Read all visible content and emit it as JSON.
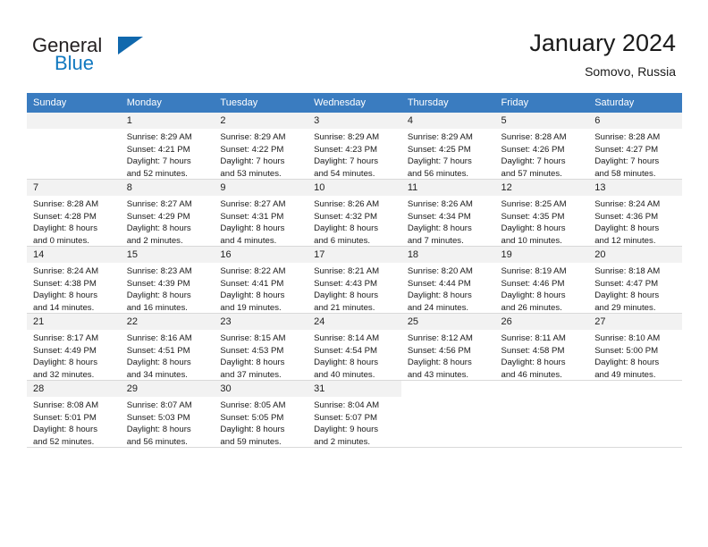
{
  "brand": {
    "name_part1": "General",
    "name_part2": "Blue",
    "accent_color": "#1279c0",
    "triangle_color": "#1068ad"
  },
  "header": {
    "title": "January 2024",
    "subtitle": "Somovo, Russia"
  },
  "calendar": {
    "header_bg": "#3a7cc0",
    "weekdays": [
      "Sunday",
      "Monday",
      "Tuesday",
      "Wednesday",
      "Thursday",
      "Friday",
      "Saturday"
    ],
    "weeks": [
      [
        {
          "day": "",
          "sunrise": "",
          "sunset": "",
          "daylight1": "",
          "daylight2": ""
        },
        {
          "day": "1",
          "sunrise": "Sunrise: 8:29 AM",
          "sunset": "Sunset: 4:21 PM",
          "daylight1": "Daylight: 7 hours",
          "daylight2": "and 52 minutes."
        },
        {
          "day": "2",
          "sunrise": "Sunrise: 8:29 AM",
          "sunset": "Sunset: 4:22 PM",
          "daylight1": "Daylight: 7 hours",
          "daylight2": "and 53 minutes."
        },
        {
          "day": "3",
          "sunrise": "Sunrise: 8:29 AM",
          "sunset": "Sunset: 4:23 PM",
          "daylight1": "Daylight: 7 hours",
          "daylight2": "and 54 minutes."
        },
        {
          "day": "4",
          "sunrise": "Sunrise: 8:29 AM",
          "sunset": "Sunset: 4:25 PM",
          "daylight1": "Daylight: 7 hours",
          "daylight2": "and 56 minutes."
        },
        {
          "day": "5",
          "sunrise": "Sunrise: 8:28 AM",
          "sunset": "Sunset: 4:26 PM",
          "daylight1": "Daylight: 7 hours",
          "daylight2": "and 57 minutes."
        },
        {
          "day": "6",
          "sunrise": "Sunrise: 8:28 AM",
          "sunset": "Sunset: 4:27 PM",
          "daylight1": "Daylight: 7 hours",
          "daylight2": "and 58 minutes."
        }
      ],
      [
        {
          "day": "7",
          "sunrise": "Sunrise: 8:28 AM",
          "sunset": "Sunset: 4:28 PM",
          "daylight1": "Daylight: 8 hours",
          "daylight2": "and 0 minutes."
        },
        {
          "day": "8",
          "sunrise": "Sunrise: 8:27 AM",
          "sunset": "Sunset: 4:29 PM",
          "daylight1": "Daylight: 8 hours",
          "daylight2": "and 2 minutes."
        },
        {
          "day": "9",
          "sunrise": "Sunrise: 8:27 AM",
          "sunset": "Sunset: 4:31 PM",
          "daylight1": "Daylight: 8 hours",
          "daylight2": "and 4 minutes."
        },
        {
          "day": "10",
          "sunrise": "Sunrise: 8:26 AM",
          "sunset": "Sunset: 4:32 PM",
          "daylight1": "Daylight: 8 hours",
          "daylight2": "and 6 minutes."
        },
        {
          "day": "11",
          "sunrise": "Sunrise: 8:26 AM",
          "sunset": "Sunset: 4:34 PM",
          "daylight1": "Daylight: 8 hours",
          "daylight2": "and 7 minutes."
        },
        {
          "day": "12",
          "sunrise": "Sunrise: 8:25 AM",
          "sunset": "Sunset: 4:35 PM",
          "daylight1": "Daylight: 8 hours",
          "daylight2": "and 10 minutes."
        },
        {
          "day": "13",
          "sunrise": "Sunrise: 8:24 AM",
          "sunset": "Sunset: 4:36 PM",
          "daylight1": "Daylight: 8 hours",
          "daylight2": "and 12 minutes."
        }
      ],
      [
        {
          "day": "14",
          "sunrise": "Sunrise: 8:24 AM",
          "sunset": "Sunset: 4:38 PM",
          "daylight1": "Daylight: 8 hours",
          "daylight2": "and 14 minutes."
        },
        {
          "day": "15",
          "sunrise": "Sunrise: 8:23 AM",
          "sunset": "Sunset: 4:39 PM",
          "daylight1": "Daylight: 8 hours",
          "daylight2": "and 16 minutes."
        },
        {
          "day": "16",
          "sunrise": "Sunrise: 8:22 AM",
          "sunset": "Sunset: 4:41 PM",
          "daylight1": "Daylight: 8 hours",
          "daylight2": "and 19 minutes."
        },
        {
          "day": "17",
          "sunrise": "Sunrise: 8:21 AM",
          "sunset": "Sunset: 4:43 PM",
          "daylight1": "Daylight: 8 hours",
          "daylight2": "and 21 minutes."
        },
        {
          "day": "18",
          "sunrise": "Sunrise: 8:20 AM",
          "sunset": "Sunset: 4:44 PM",
          "daylight1": "Daylight: 8 hours",
          "daylight2": "and 24 minutes."
        },
        {
          "day": "19",
          "sunrise": "Sunrise: 8:19 AM",
          "sunset": "Sunset: 4:46 PM",
          "daylight1": "Daylight: 8 hours",
          "daylight2": "and 26 minutes."
        },
        {
          "day": "20",
          "sunrise": "Sunrise: 8:18 AM",
          "sunset": "Sunset: 4:47 PM",
          "daylight1": "Daylight: 8 hours",
          "daylight2": "and 29 minutes."
        }
      ],
      [
        {
          "day": "21",
          "sunrise": "Sunrise: 8:17 AM",
          "sunset": "Sunset: 4:49 PM",
          "daylight1": "Daylight: 8 hours",
          "daylight2": "and 32 minutes."
        },
        {
          "day": "22",
          "sunrise": "Sunrise: 8:16 AM",
          "sunset": "Sunset: 4:51 PM",
          "daylight1": "Daylight: 8 hours",
          "daylight2": "and 34 minutes."
        },
        {
          "day": "23",
          "sunrise": "Sunrise: 8:15 AM",
          "sunset": "Sunset: 4:53 PM",
          "daylight1": "Daylight: 8 hours",
          "daylight2": "and 37 minutes."
        },
        {
          "day": "24",
          "sunrise": "Sunrise: 8:14 AM",
          "sunset": "Sunset: 4:54 PM",
          "daylight1": "Daylight: 8 hours",
          "daylight2": "and 40 minutes."
        },
        {
          "day": "25",
          "sunrise": "Sunrise: 8:12 AM",
          "sunset": "Sunset: 4:56 PM",
          "daylight1": "Daylight: 8 hours",
          "daylight2": "and 43 minutes."
        },
        {
          "day": "26",
          "sunrise": "Sunrise: 8:11 AM",
          "sunset": "Sunset: 4:58 PM",
          "daylight1": "Daylight: 8 hours",
          "daylight2": "and 46 minutes."
        },
        {
          "day": "27",
          "sunrise": "Sunrise: 8:10 AM",
          "sunset": "Sunset: 5:00 PM",
          "daylight1": "Daylight: 8 hours",
          "daylight2": "and 49 minutes."
        }
      ],
      [
        {
          "day": "28",
          "sunrise": "Sunrise: 8:08 AM",
          "sunset": "Sunset: 5:01 PM",
          "daylight1": "Daylight: 8 hours",
          "daylight2": "and 52 minutes."
        },
        {
          "day": "29",
          "sunrise": "Sunrise: 8:07 AM",
          "sunset": "Sunset: 5:03 PM",
          "daylight1": "Daylight: 8 hours",
          "daylight2": "and 56 minutes."
        },
        {
          "day": "30",
          "sunrise": "Sunrise: 8:05 AM",
          "sunset": "Sunset: 5:05 PM",
          "daylight1": "Daylight: 8 hours",
          "daylight2": "and 59 minutes."
        },
        {
          "day": "31",
          "sunrise": "Sunrise: 8:04 AM",
          "sunset": "Sunset: 5:07 PM",
          "daylight1": "Daylight: 9 hours",
          "daylight2": "and 2 minutes."
        },
        {
          "day": "",
          "sunrise": "",
          "sunset": "",
          "daylight1": "",
          "daylight2": ""
        },
        {
          "day": "",
          "sunrise": "",
          "sunset": "",
          "daylight1": "",
          "daylight2": ""
        },
        {
          "day": "",
          "sunrise": "",
          "sunset": "",
          "daylight1": "",
          "daylight2": ""
        }
      ]
    ]
  }
}
